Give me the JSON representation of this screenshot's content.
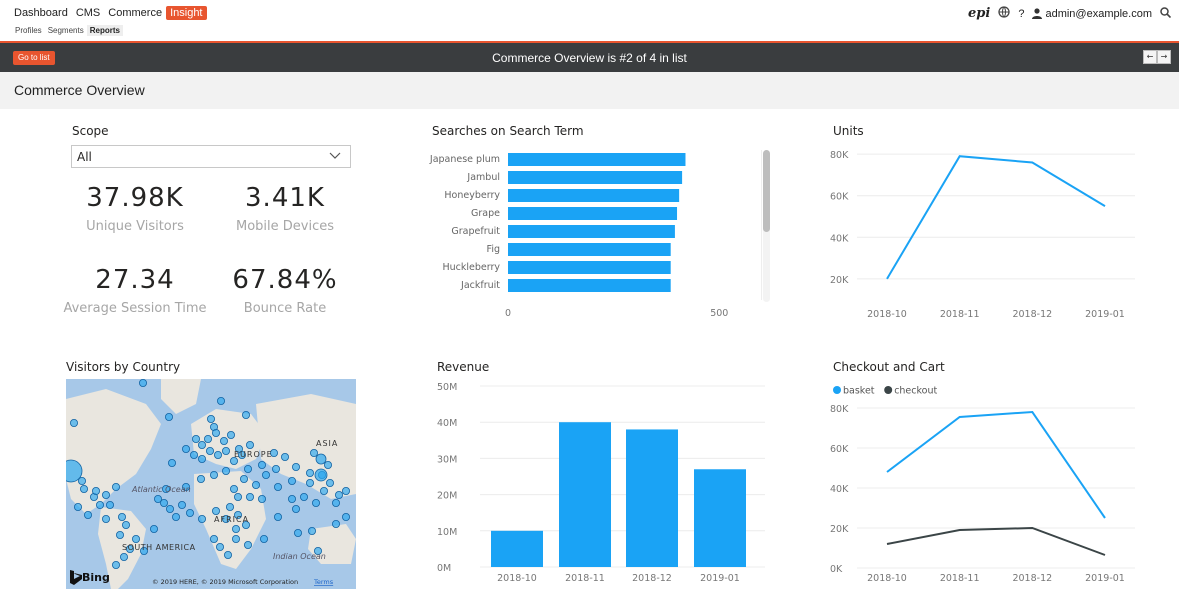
{
  "nav": {
    "main": [
      "Dashboard",
      "CMS",
      "Commerce",
      "Insight"
    ],
    "active_main": "Insight",
    "sub": [
      "Profiles",
      "Segments",
      "Reports"
    ],
    "active_sub": "Reports",
    "user": "admin@example.com",
    "help": "?",
    "logo": "epi"
  },
  "context": {
    "go_to_list": "Go to list",
    "title": "Commerce Overview is #2 of 4 in list",
    "prev": "←",
    "next": "→"
  },
  "page": {
    "title": "Commerce Overview"
  },
  "scope": {
    "title": "Scope",
    "selected": "All",
    "kpis": [
      {
        "value": "37.98K",
        "label": "Unique Visitors"
      },
      {
        "value": "3.41K",
        "label": "Mobile Devices"
      },
      {
        "value": "27.34",
        "label": "Average Session Time"
      },
      {
        "value": "67.84%",
        "label": "Bounce Rate"
      }
    ]
  },
  "map": {
    "title": "Visitors by Country",
    "labels": [
      "EUROPE",
      "ASIA",
      "Atlantic Ocean",
      "AFRICA",
      "SOUTH AMERICA",
      "Indian Ocean"
    ],
    "bing": "Bing",
    "copyright": "© 2019 HERE, © 2019 Microsoft Corporation",
    "terms": "Terms"
  },
  "colors": {
    "accent": "#e8552f",
    "series": "#1aa3f5",
    "series2": "#3b4547",
    "dark_bar": "#3a3d3f"
  },
  "chart_data": [
    {
      "type": "bar",
      "orientation": "horizontal",
      "title": "Searches on Search Term",
      "categories": [
        "Japanese plum",
        "Jambul",
        "Honeyberry",
        "Grape",
        "Grapefruit",
        "Fig",
        "Huckleberry",
        "Jackfruit"
      ],
      "values": [
        420,
        412,
        405,
        400,
        395,
        385,
        385,
        385
      ],
      "x_ticks": [
        "0",
        "500"
      ],
      "xlim": [
        0,
        620
      ]
    },
    {
      "type": "line",
      "title": "Units",
      "categories": [
        "2018-10",
        "2018-11",
        "2018-12",
        "2019-01"
      ],
      "series": [
        {
          "values": [
            20000,
            79000,
            76000,
            55000
          ]
        }
      ],
      "y_ticks": [
        "20K",
        "40K",
        "60K",
        "80K"
      ],
      "ylim": [
        18000,
        82000
      ]
    },
    {
      "type": "bar",
      "title": "Revenue",
      "categories": [
        "2018-10",
        "2018-11",
        "2018-12",
        "2019-01"
      ],
      "values": [
        10000000,
        40000000,
        38000000,
        27000000
      ],
      "y_ticks": [
        "0M",
        "10M",
        "20M",
        "30M",
        "40M",
        "50M"
      ],
      "ylim": [
        0,
        50000000
      ]
    },
    {
      "type": "line",
      "title": "Checkout and Cart",
      "categories": [
        "2018-10",
        "2018-11",
        "2018-12",
        "2019-01"
      ],
      "series": [
        {
          "name": "basket",
          "values": [
            48000,
            75500,
            78000,
            25000
          ]
        },
        {
          "name": "checkout",
          "values": [
            12000,
            19000,
            20000,
            6500
          ]
        }
      ],
      "y_ticks": [
        "0K",
        "20K",
        "40K",
        "60K",
        "80K"
      ],
      "ylim": [
        0,
        80000
      ],
      "legend": "top-left"
    }
  ]
}
